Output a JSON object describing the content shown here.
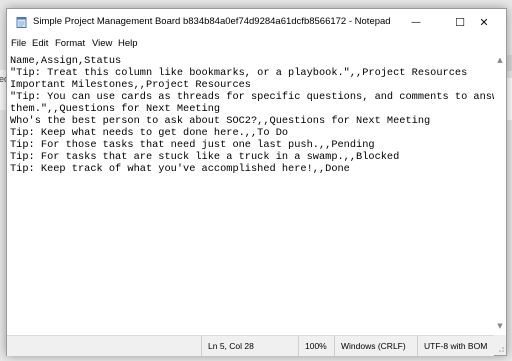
{
  "background": {
    "left_fragment": "eds"
  },
  "window": {
    "title": "Simple Project Management Board b834b84a0ef74d9284a61dcfb8566172 - Notepad",
    "icon": "notepad-icon",
    "controls": {
      "minimize": "—",
      "maximize": "☐",
      "close": "✕"
    }
  },
  "menu": [
    "File",
    "Edit",
    "Format",
    "View",
    "Help"
  ],
  "editor": {
    "lines": [
      "Name,Assign,Status",
      "\"Tip: Treat this column like bookmarks, or a playbook.\",,Project Resources",
      "Important Milestones,,Project Resources",
      "\"Tip: You can use cards as threads for specific questions, and comments to answer",
      "them.\",,Questions for Next Meeting",
      "Who's the best person to ask about SOC2?,,Questions for Next Meeting",
      "Tip: Keep what needs to get done here.,,To Do",
      "Tip: For those tasks that need just one last push.,,Pending",
      "Tip: For tasks that are stuck like a truck in a swamp.,,Blocked",
      "Tip: Keep track of what you've accomplished here!,,Done"
    ]
  },
  "status": {
    "position": "Ln 5, Col 28",
    "zoom": "100%",
    "line_endings": "Windows (CRLF)",
    "encoding": "UTF-8 with BOM"
  }
}
